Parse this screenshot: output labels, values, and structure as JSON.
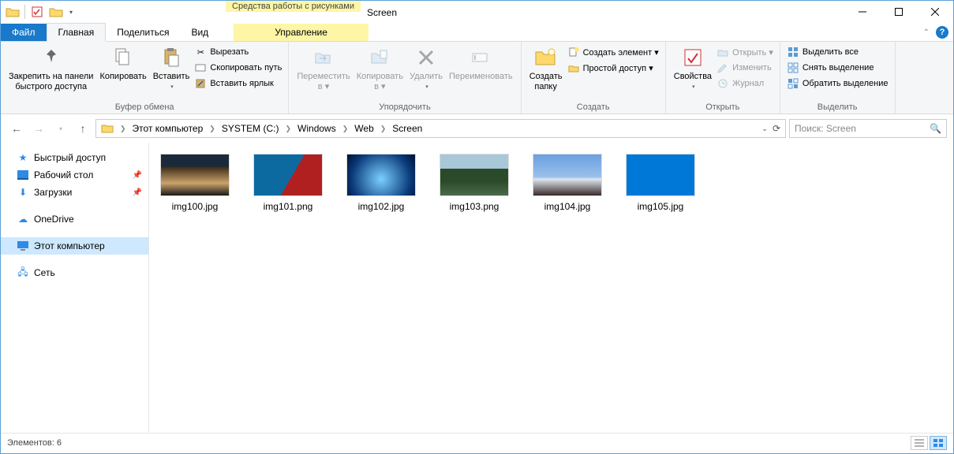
{
  "titlebar": {
    "context_tab": "Средства работы с рисунками",
    "title": "Screen"
  },
  "tabs": {
    "file": "Файл",
    "home": "Главная",
    "share": "Поделиться",
    "view": "Вид",
    "manage": "Управление"
  },
  "ribbon": {
    "pin": "Закрепить на панели\nбыстрого доступа",
    "copy": "Копировать",
    "paste": "Вставить",
    "cut": "Вырезать",
    "copypath": "Скопировать путь",
    "paste_shortcut": "Вставить ярлык",
    "clipboard": "Буфер обмена",
    "moveto": "Переместить\nв ▾",
    "copyto": "Копировать\nв ▾",
    "delete": "Удалить",
    "rename": "Переименовать",
    "organize": "Упорядочить",
    "newfolder": "Создать\nпапку",
    "newitem": "Создать элемент ▾",
    "easyaccess": "Простой доступ ▾",
    "create": "Создать",
    "properties": "Свойства",
    "open": "Открыть ▾",
    "edit": "Изменить",
    "history": "Журнал",
    "open_group": "Открыть",
    "selectall": "Выделить все",
    "selectnone": "Снять выделение",
    "invertsel": "Обратить выделение",
    "select_group": "Выделить"
  },
  "breadcrumb": {
    "c0": "Этот компьютер",
    "c1": "SYSTEM (C:)",
    "c2": "Windows",
    "c3": "Web",
    "c4": "Screen"
  },
  "search": {
    "placeholder": "Поиск: Screen"
  },
  "nav": {
    "quick": "Быстрый доступ",
    "desktop": "Рабочий стол",
    "downloads": "Загрузки",
    "onedrive": "OneDrive",
    "thispc": "Этот компьютер",
    "network": "Сеть"
  },
  "files": [
    {
      "name": "img100.jpg",
      "thumb": "t0"
    },
    {
      "name": "img101.png",
      "thumb": "t1"
    },
    {
      "name": "img102.jpg",
      "thumb": "t2"
    },
    {
      "name": "img103.png",
      "thumb": "t3"
    },
    {
      "name": "img104.jpg",
      "thumb": "t4"
    },
    {
      "name": "img105.jpg",
      "thumb": "t5"
    }
  ],
  "status": {
    "items": "Элементов: 6"
  }
}
